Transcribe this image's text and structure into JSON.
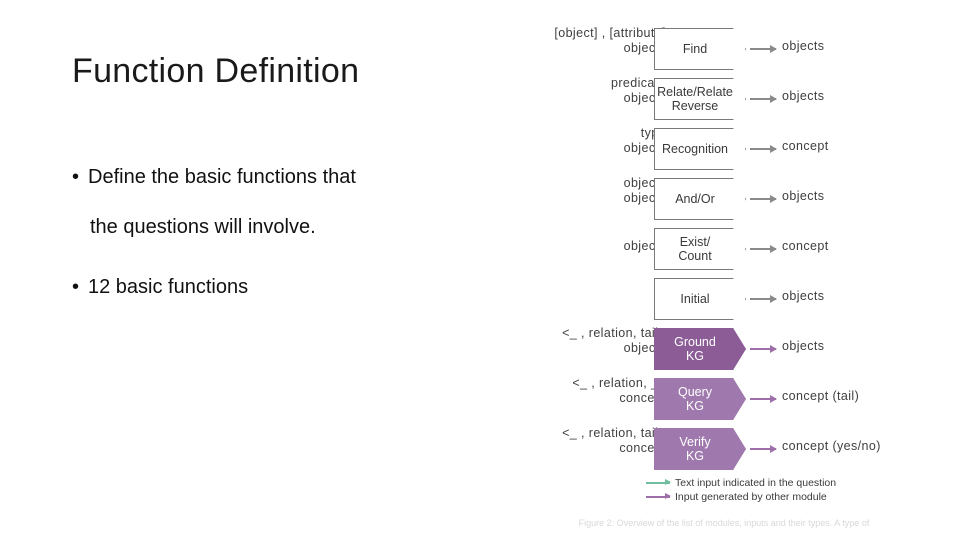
{
  "slide": {
    "title": "Function Definition",
    "bullets": [
      {
        "marker": "•",
        "line1": "Define the basic functions that",
        "line2": "the questions will involve."
      },
      {
        "marker": "•",
        "line1": "12 basic functions"
      }
    ]
  },
  "figure": {
    "rows": [
      {
        "input_line1": "[object] , [attribute]",
        "input_line2": "objects",
        "module": "Find",
        "module_line2": "",
        "output": "objects",
        "in_arrow": "gray",
        "out_arrow": "gray",
        "style": "plain"
      },
      {
        "input_line1": "predicate",
        "input_line2": "objects",
        "module": "Relate/Relate",
        "module_line2": "Reverse",
        "output": "objects",
        "in_arrow": "gray",
        "out_arrow": "gray",
        "style": "plain"
      },
      {
        "input_line1": "type",
        "input_line2": "objects",
        "module": "Recognition",
        "module_line2": "",
        "output": "concept",
        "in_arrow": "gray",
        "out_arrow": "gray",
        "style": "plain"
      },
      {
        "input_line1": "objects",
        "input_line2": "objects",
        "module": "And/Or",
        "module_line2": "",
        "output": "objects",
        "in_arrow": "gray",
        "out_arrow": "gray",
        "style": "plain"
      },
      {
        "input_line1": "",
        "input_line2": "objects",
        "module": "Exist/",
        "module_line2": "Count",
        "output": "concept",
        "in_arrow": "gray",
        "out_arrow": "gray",
        "style": "plain"
      },
      {
        "input_line1": "",
        "input_line2": "",
        "module": "Initial",
        "module_line2": "",
        "output": "objects",
        "in_arrow": "none",
        "out_arrow": "gray",
        "style": "plain"
      },
      {
        "input_line1": "<_ , relation, tail>",
        "input_line2": "objects",
        "module": "Ground",
        "module_line2": "KG",
        "output": "objects",
        "in_arrow": "green",
        "out_arrow": "purple",
        "style": "kg"
      },
      {
        "input_line1": "<_ , relation, _>",
        "input_line2": "concept",
        "module": "Query",
        "module_line2": "KG",
        "output": "concept (tail)",
        "in_arrow": "green",
        "out_arrow": "purple",
        "style": "kg light"
      },
      {
        "input_line1": "<_ , relation, tail>",
        "input_line2": "concept",
        "module": "Verify",
        "module_line2": "KG",
        "output": "concept (yes/no)",
        "in_arrow": "green",
        "out_arrow": "purple",
        "style": "kg light"
      }
    ],
    "legend": [
      {
        "color": "green",
        "label": "Text input indicated in the question"
      },
      {
        "color": "purple",
        "label": "Input generated by other module"
      }
    ],
    "caption": "Figure 2: Overview of the list of modules, inputs and their types. A type of"
  },
  "colors": {
    "kg_purple": "#8c5c96",
    "kg_purple_light": "#9f79ad",
    "arrow_green": "#6fbfa0",
    "arrow_purple": "#9d6fa8",
    "arrow_gray": "#8a8a8a",
    "text": "#3f3f3f"
  }
}
